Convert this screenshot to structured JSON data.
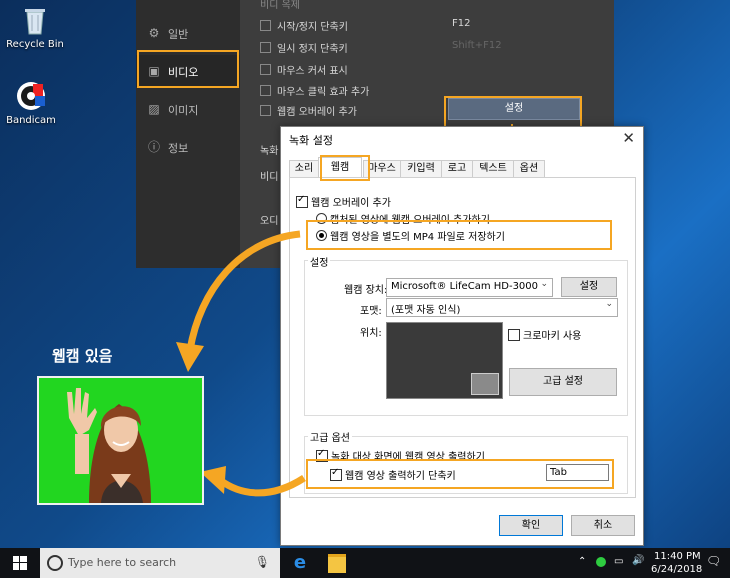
{
  "desktop": {
    "icons": [
      {
        "label": "Recycle Bin"
      },
      {
        "label": "Bandicam"
      }
    ]
  },
  "bandicam": {
    "sidebar": [
      {
        "label": "일반",
        "icon": "gear-icon"
      },
      {
        "label": "비디오",
        "icon": "video-settings-icon"
      },
      {
        "label": "이미지",
        "icon": "image-icon"
      },
      {
        "label": "정보",
        "icon": "info-icon"
      }
    ],
    "section_title": "비디 옥제",
    "options": [
      {
        "label": "시작/정지 단축키",
        "value": "F12"
      },
      {
        "label": "일시 정지 단축키",
        "value": "Shift+F12"
      },
      {
        "label": "마우스 커서 표시"
      },
      {
        "label": "마우스 클릭 효과 추가"
      },
      {
        "label": "웹캠 오버레이 추가"
      }
    ],
    "settings_button": "설정",
    "record_label": "녹화",
    "video_label": "비디",
    "audio_label": "오디"
  },
  "dialog": {
    "title": "녹화 설정",
    "tabs": [
      "소리",
      "웹캠",
      "마우스",
      "키입력",
      "로고",
      "텍스트",
      "옵션"
    ],
    "webcam_overlay_label": "웹캠 오버레이 추가",
    "radio_captured": "캡처된 영상에 웹캠 오버레이 추가하기",
    "radio_separate": "웹캠 영상을 별도의 MP4 파일로 저장하기",
    "settings_group": "설정",
    "device_label": "웹캠 장치:",
    "device_value": "Microsoft® LifeCam HD-3000",
    "device_settings_button": "설정",
    "format_label": "포맷:",
    "format_value": "(포맷 자동 인식)",
    "position_label": "위치:",
    "chroma_label": "크로마키 사용",
    "advanced_button": "고급 설정",
    "advanced_group": "고급 옵션",
    "output_on_screen": "녹화 대상 화면에 웹캠 영상 출력하기",
    "output_hotkey": "웹캠 영상 출력하기 단축키",
    "hotkey_value": "Tab",
    "ok_button": "확인",
    "cancel_button": "취소"
  },
  "annotation": {
    "webcam_caption": "웹캠 있음"
  },
  "taskbar": {
    "search_placeholder": "Type here to search",
    "time": "11:40 PM",
    "date": "6/24/2018"
  },
  "colors": {
    "highlight": "#f5a623",
    "chroma_green": "#22d620"
  }
}
